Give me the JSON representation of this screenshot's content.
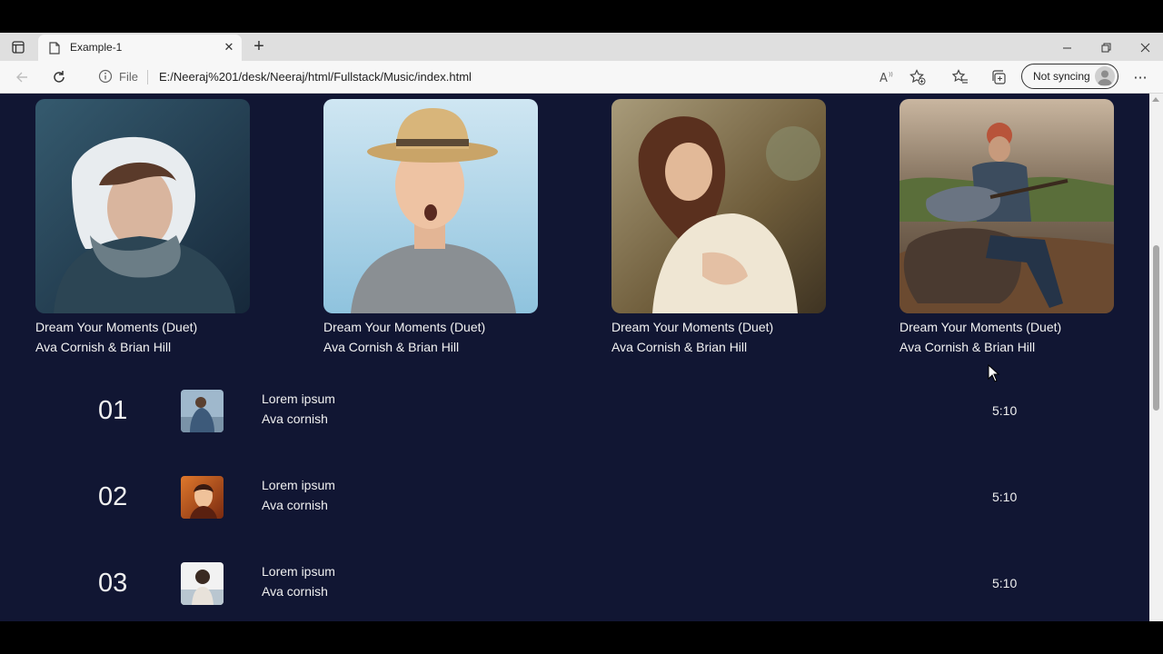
{
  "browser": {
    "tab_title": "Example-1",
    "address_scheme_label": "File",
    "url": "E:/Neeraj%201/desk/Neeraj/html/Fullstack/Music/index.html",
    "sync_label": "Not syncing"
  },
  "colors": {
    "page_background": "#111633",
    "text": "#f2f2f2"
  },
  "albums": [
    {
      "title": "Dream Your Moments (Duet)",
      "artist": "Ava Cornish & Brian Hill",
      "image": "woman in winter hood"
    },
    {
      "title": "Dream Your Moments (Duet)",
      "artist": "Ava Cornish & Brian Hill",
      "image": "surprised man in straw hat"
    },
    {
      "title": "Dream Your Moments (Duet)",
      "artist": "Ava Cornish & Brian Hill",
      "image": "woman with long hair outdoors"
    },
    {
      "title": "Dream Your Moments (Duet)",
      "artist": "Ava Cornish & Brian Hill",
      "image": "man playing guitar on rock"
    }
  ],
  "tracks": [
    {
      "number": "01",
      "title": "Lorem ipsum",
      "artist": "Ava cornish",
      "duration": "5:10"
    },
    {
      "number": "02",
      "title": "Lorem ipsum",
      "artist": "Ava cornish",
      "duration": "5:10"
    },
    {
      "number": "03",
      "title": "Lorem ipsum",
      "artist": "Ava cornish",
      "duration": "5:10"
    }
  ]
}
